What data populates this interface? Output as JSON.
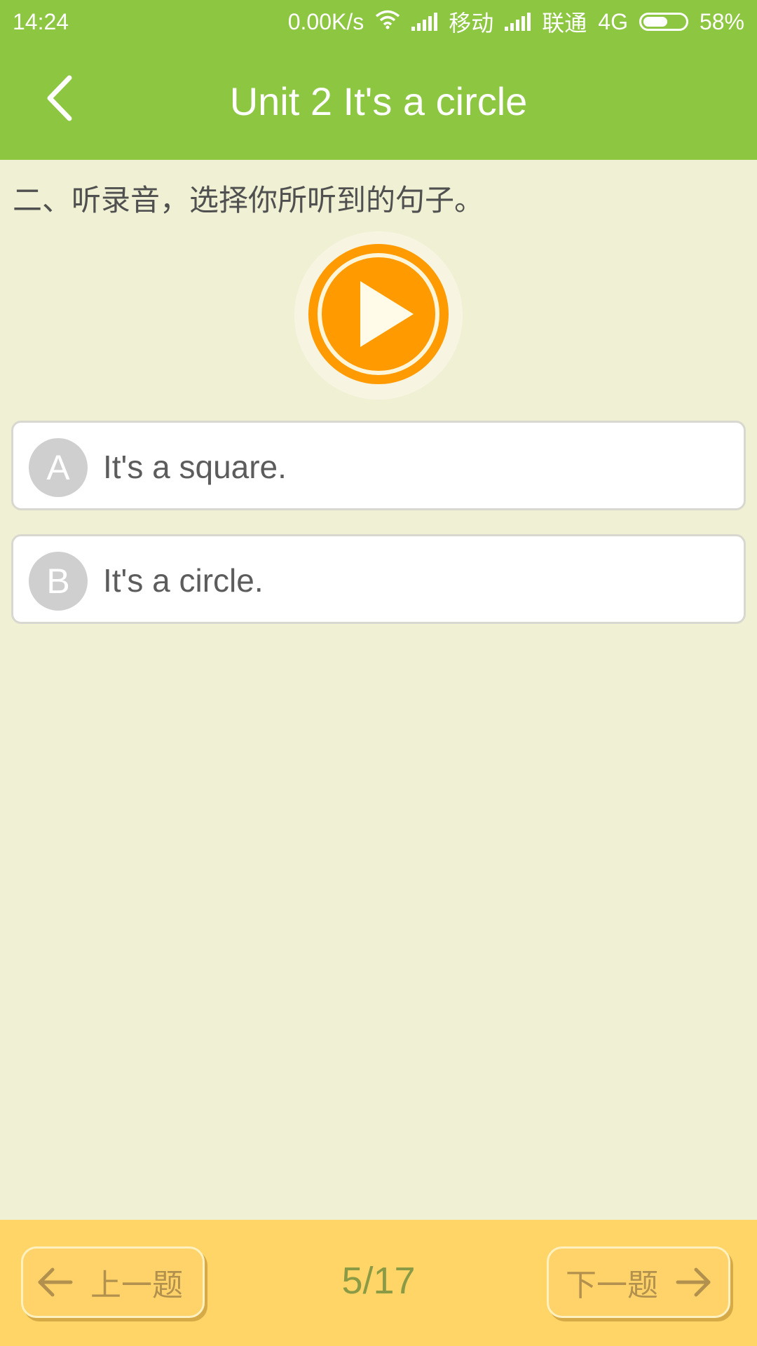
{
  "status_bar": {
    "time": "14:24",
    "net_speed": "0.00K/s",
    "carrier1": "移动",
    "carrier2": "联通",
    "network_type": "4G",
    "battery_text": "58%",
    "battery_level": 0.58
  },
  "app_bar": {
    "title": "Unit 2 It's a circle",
    "back_icon": "chevron-left-icon"
  },
  "question": {
    "text": "二、听录音，选择你所听到的句子。"
  },
  "player": {
    "icon": "play-icon",
    "accent_color": "#ff9a00"
  },
  "options": [
    {
      "letter": "A",
      "text": "It's a square."
    },
    {
      "letter": "B",
      "text": "It's a circle."
    }
  ],
  "footer": {
    "prev_label": "上一题",
    "next_label": "下一题",
    "progress": "5/17"
  },
  "colors": {
    "header": "#8dc640",
    "background": "#f0f0d4",
    "footer": "#ffd567"
  }
}
